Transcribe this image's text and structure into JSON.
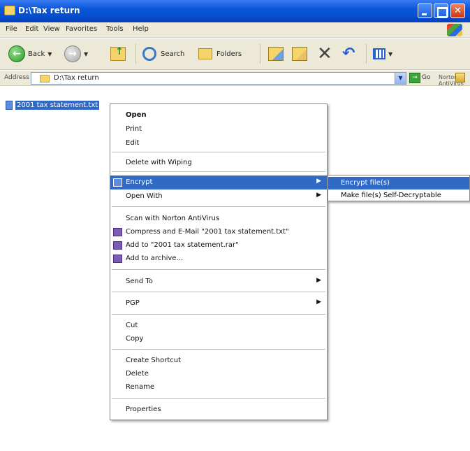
{
  "window": {
    "title": "D:\\Tax return",
    "minimize_glyph": "",
    "maximize_glyph": "",
    "close_glyph": "✕"
  },
  "menubar": {
    "items": [
      "File",
      "Edit",
      "View",
      "Favorites",
      "Tools",
      "Help"
    ]
  },
  "toolbar": {
    "back_label": "Back",
    "search_label": "Search",
    "folders_label": "Folders"
  },
  "address": {
    "label": "Address",
    "path": "D:\\Tax return",
    "go_label": "Go",
    "norton_label": "Norton AntiVirus"
  },
  "files": [
    {
      "name": "2001 tax statement.txt"
    }
  ],
  "context_menu": {
    "items": [
      {
        "label": "Open",
        "bold": true
      },
      {
        "label": "Print"
      },
      {
        "label": "Edit"
      },
      {
        "label": "Delete with Wiping"
      },
      {
        "label": "Encrypt",
        "submenu": "▶",
        "highlighted": true
      },
      {
        "label": "Open With",
        "submenu": "▶"
      },
      {
        "label": "Scan with Norton AntiVirus"
      },
      {
        "label": "Compress and E-Mail \"2001 tax statement.txt\""
      },
      {
        "label": "Add to \"2001 tax statement.rar\""
      },
      {
        "label": "Add to archive..."
      },
      {
        "label": "Send To",
        "submenu": "▶"
      },
      {
        "label": "PGP",
        "submenu": "▶"
      },
      {
        "label": "Cut"
      },
      {
        "label": "Copy"
      },
      {
        "label": "Create Shortcut"
      },
      {
        "label": "Delete"
      },
      {
        "label": "Rename"
      },
      {
        "label": "Properties"
      }
    ]
  },
  "submenu": {
    "items": [
      {
        "label": "Encrypt file(s)",
        "highlighted": true
      },
      {
        "label": "Make file(s) Self-Decryptable"
      }
    ]
  }
}
